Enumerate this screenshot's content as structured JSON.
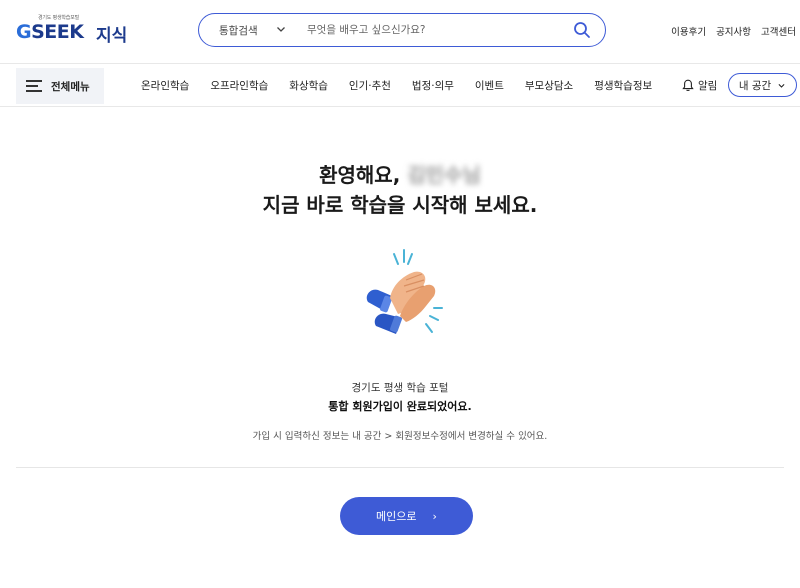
{
  "header": {
    "logo_tagline": "경기도 평생학습포털",
    "logo_brand_g": "G",
    "logo_brand_rest": "SEEK",
    "logo_service": "지식",
    "search": {
      "scope": "통합검색",
      "placeholder": "무엇을 배우고 싶으신가요?",
      "value": ""
    },
    "links": [
      "이용후기",
      "공지사항",
      "고객센터"
    ]
  },
  "nav": {
    "all_menu_label": "전체메뉴",
    "items": [
      "온라인학습",
      "오프라인학습",
      "화상학습",
      "인기·추천",
      "법정·의무",
      "이벤트",
      "부모상담소",
      "평생학습정보"
    ],
    "alarm_label": "알림",
    "my_space_label": "내 공간"
  },
  "content": {
    "greeting_prefix": "환영해요,",
    "user_name_blurred": "김민수님",
    "greeting_line2": "지금 바로 학습을 시작해 보세요.",
    "portal_line": "경기도 평생 학습 포털",
    "complete_line": "통합 회원가입이 완료되었어요.",
    "info_line": "가입 시 입력하신 정보는 내 공간 > 회원정보수정에서 변경하실 수 있어요.",
    "main_button_label": "메인으로",
    "main_button_arrow": "›"
  },
  "colors": {
    "accent": "#3e5bd6",
    "brand_navy": "#1c3a8c"
  }
}
